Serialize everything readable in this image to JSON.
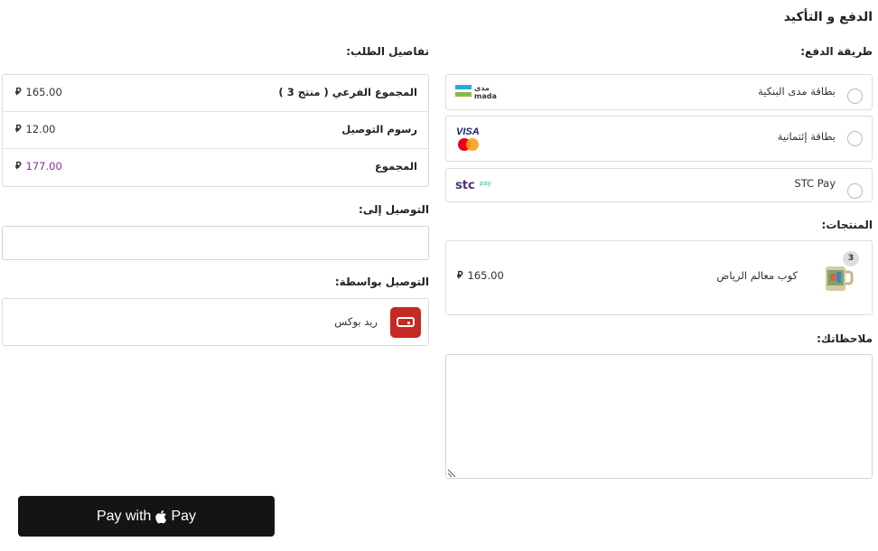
{
  "page": {
    "title": "الدفع و التأكيد"
  },
  "payment": {
    "label": "طريقة الدفع:",
    "options": [
      {
        "label": "بطاقة مدى البنكية",
        "logo": "mada-logo"
      },
      {
        "label": "بطاقة إئتمانية",
        "logo": "visa-mastercard-logo"
      },
      {
        "label": "STC Pay",
        "logo": "stc-pay-logo"
      }
    ]
  },
  "order": {
    "label": "تفاصيل الطلب:",
    "rows": [
      {
        "label": "المجموع الفرعي ( منتج 3 )",
        "value": "165.00"
      },
      {
        "label": "رسوم التوصيل",
        "value": "12.00"
      },
      {
        "label": "المجموع",
        "value": "177.00"
      }
    ],
    "currency_symbol": "⃁"
  },
  "delivery_to": {
    "label": "التوصيل إلى:",
    "value": ""
  },
  "delivery_by": {
    "label": "التوصيل بواسطة:",
    "carrier": "ريد بوكس"
  },
  "products": {
    "label": "المنتجات:",
    "items": [
      {
        "name": "كوب معالم الرياض",
        "qty": "3",
        "price": "165.00"
      }
    ]
  },
  "notes": {
    "label": "ملاحظاتك:",
    "value": ""
  },
  "apple_pay": {
    "label_left": "Pay with",
    "label_right": "Pay"
  },
  "colors": {
    "total": "#8a2fa0",
    "redbox": "#c62a24",
    "apple_pay_bg": "#141414"
  }
}
